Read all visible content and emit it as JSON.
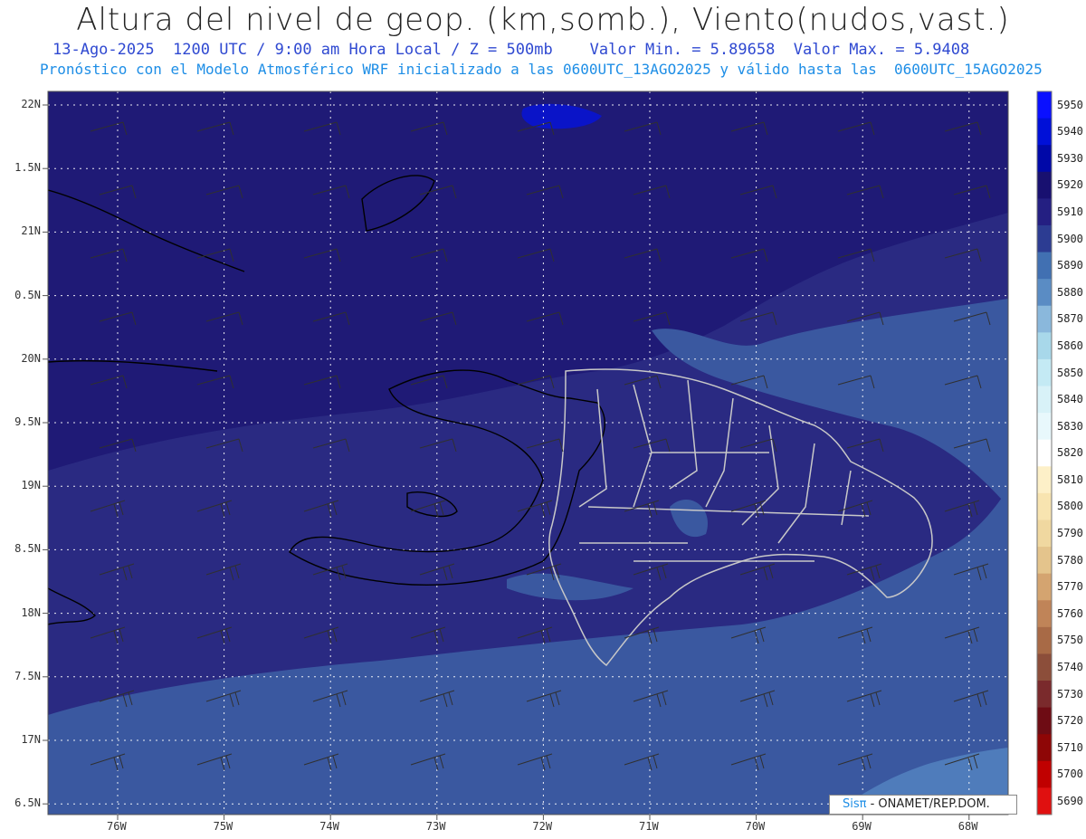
{
  "header": {
    "title": "Altura del nivel de geop. (km,somb.), Viento(nudos,vast.)",
    "line1": "13-Ago-2025  1200 UTC / 9:00 am Hora Local / Z = 500mb    Valor Min. = 5.89658  Valor Max. = 5.9408",
    "line2": "Pronóstico con el Modelo Atmosférico WRF inicializado a las 0600UTC_13AGO2025 y válido hasta las  0600UTC_15AGO2025"
  },
  "axes": {
    "lat_labels": [
      "22N",
      "1.5N",
      "21N",
      "0.5N",
      "20N",
      "9.5N",
      "19N",
      "8.5N",
      "18N",
      "7.5N",
      "17N",
      "6.5N"
    ],
    "lon_labels": [
      "76W",
      "75W",
      "74W",
      "73W",
      "72W",
      "71W",
      "70W",
      "69W",
      "68W"
    ]
  },
  "colorbar": {
    "levels": [
      5950,
      5940,
      5930,
      5920,
      5910,
      5900,
      5890,
      5880,
      5870,
      5860,
      5850,
      5840,
      5830,
      5820,
      5810,
      5800,
      5790,
      5780,
      5770,
      5760,
      5750,
      5740,
      5730,
      5720,
      5710,
      5700,
      5690
    ],
    "colors": [
      "#0a10ff",
      "#0010d8",
      "#0008a8",
      "#181070",
      "#241f82",
      "#2c3c92",
      "#4170b2",
      "#5a8cc4",
      "#8ab8dc",
      "#a8d8ea",
      "#c4eaf4",
      "#d8f2f8",
      "#e8f8fc",
      "#ffffff",
      "#fdf0c8",
      "#f8e4b0",
      "#f0d8a0",
      "#e4c48c",
      "#d4a470",
      "#c08458",
      "#a86a46",
      "#8c4e3a",
      "#7a2a2c",
      "#6e0c14",
      "#8e0606",
      "#c00000",
      "#e01010"
    ]
  },
  "credit": {
    "brand": "Sisπ",
    "org": " - ONAMET/REP.DOM."
  },
  "map_colors": {
    "deep": "#1f1a76",
    "mid": "#2a2a82",
    "light": "#3a58a0",
    "lightest": "#4f7cbb"
  }
}
